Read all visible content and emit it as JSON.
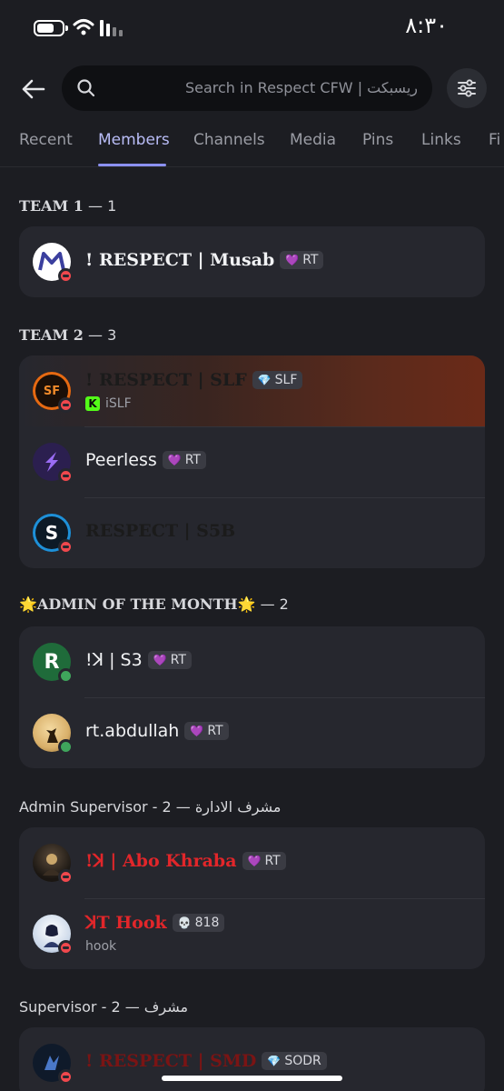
{
  "status_bar": {
    "time": "٨:٣٠"
  },
  "search": {
    "placeholder": "Search in Respect CFW | ريسبكت"
  },
  "tabs": [
    "Recent",
    "Members",
    "Channels",
    "Media",
    "Pins",
    "Links",
    "Fi"
  ],
  "active_tab": "Members",
  "sections": [
    {
      "title": "TEAM 1",
      "count": " — 1",
      "members": [
        {
          "name": "! RESPECT | Musab",
          "tag": "RT",
          "tag_icon": "purple-heart",
          "status": "dnd"
        }
      ]
    },
    {
      "title": "TEAM 2",
      "count": " — 3",
      "members": [
        {
          "name": "! RESPECT | SLF",
          "tag": "SLF",
          "tag_icon": "orange-gem",
          "sub": "iSLF",
          "status": "dnd"
        },
        {
          "name": "Peerless",
          "tag": "RT",
          "tag_icon": "purple-heart",
          "status": "dnd"
        },
        {
          "name": "RESPECT | S5B",
          "status": "dnd"
        }
      ]
    },
    {
      "title": "🌟ADMIN OF THE MONTH🌟",
      "count": " — 2",
      "members": [
        {
          "name": "!ꓘ | S3",
          "tag": "RT",
          "tag_icon": "purple-heart",
          "status": "online"
        },
        {
          "name": "rt.abdullah",
          "tag": "RT",
          "tag_icon": "purple-heart",
          "status": "online"
        }
      ]
    },
    {
      "title": "Admin Supervisor - 2",
      "count": " — مشرف الادارة",
      "members": [
        {
          "name": "!ꓘ | Abo Khraba",
          "tag": "RT",
          "tag_icon": "purple-heart",
          "status": "dnd"
        },
        {
          "name": "ꓘT Hook",
          "tag": "818",
          "tag_icon": "skull",
          "sub": "hook",
          "status": "dnd"
        }
      ]
    },
    {
      "title": "Supervisor - 2",
      "count": " — مشرف",
      "members": [
        {
          "name": "! RESPECT | SMD",
          "tag": "SODR",
          "tag_icon": "blue-gem",
          "status": "dnd"
        }
      ]
    }
  ],
  "colors": {
    "accent": "#8b90f0",
    "dnd": "#f0484d",
    "online": "#3fa55c",
    "background": "#1c1d22",
    "card": "#26272e"
  }
}
